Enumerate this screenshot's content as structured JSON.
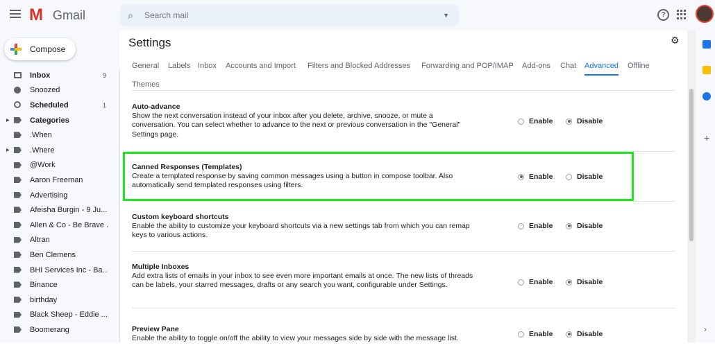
{
  "app": {
    "name": "Gmail"
  },
  "search": {
    "placeholder": "Search mail"
  },
  "sidebar": {
    "compose_label": "Compose",
    "items": [
      {
        "label": "Inbox",
        "count": "9",
        "bold": true,
        "icon": "inbox"
      },
      {
        "label": "Snoozed",
        "count": "",
        "bold": false,
        "icon": "clock"
      },
      {
        "label": "Scheduled",
        "count": "1",
        "bold": true,
        "icon": "sched"
      },
      {
        "label": "Categories",
        "count": "",
        "bold": true,
        "icon": "label",
        "arrow": true
      },
      {
        "label": ".When",
        "count": "",
        "bold": false,
        "icon": "label"
      },
      {
        "label": ".Where",
        "count": "",
        "bold": false,
        "icon": "label",
        "arrow": true
      },
      {
        "label": "@Work",
        "count": "",
        "bold": false,
        "icon": "label"
      },
      {
        "label": "Aaron Freeman",
        "count": "",
        "bold": false,
        "icon": "label"
      },
      {
        "label": "Advertising",
        "count": "",
        "bold": false,
        "icon": "label"
      },
      {
        "label": "Afeisha Burgin - 9 Ju...",
        "count": "",
        "bold": false,
        "icon": "label"
      },
      {
        "label": "Allen & Co - Be Brave ...",
        "count": "",
        "bold": false,
        "icon": "label"
      },
      {
        "label": "Altran",
        "count": "",
        "bold": false,
        "icon": "label"
      },
      {
        "label": "Ben Clemens",
        "count": "",
        "bold": false,
        "icon": "label"
      },
      {
        "label": "BHI Services Inc - Ba...",
        "count": "",
        "bold": false,
        "icon": "label"
      },
      {
        "label": "Binance",
        "count": "",
        "bold": false,
        "icon": "label"
      },
      {
        "label": "birthday",
        "count": "",
        "bold": false,
        "icon": "label"
      },
      {
        "label": "Black Sheep - Eddie ...",
        "count": "",
        "bold": false,
        "icon": "label"
      },
      {
        "label": "Boomerang",
        "count": "",
        "bold": false,
        "icon": "label"
      }
    ]
  },
  "settings": {
    "title": "Settings",
    "tabs": [
      "General",
      "Labels",
      "Inbox",
      "Accounts and Import",
      "Filters and Blocked Addresses",
      "Forwarding and POP/IMAP",
      "Add-ons",
      "Chat",
      "Advanced",
      "Offline",
      "Themes"
    ],
    "active_tab": "Advanced",
    "enable_label": "Enable",
    "disable_label": "Disable",
    "rows": [
      {
        "title": "Auto-advance",
        "desc": "Show the next conversation instead of your inbox after you delete, archive, snooze, or mute a conversation. You can select whether to advance to the next or previous conversation in the \"General\" Settings page.",
        "selected": "Disable"
      },
      {
        "title": "Canned Responses (Templates)",
        "desc": "Create a templated response by saving common messages using a button in compose toolbar. Also automatically send templated responses using filters.",
        "selected": "Enable"
      },
      {
        "title": "Custom keyboard shortcuts",
        "desc": "Enable the ability to customize your keyboard shortcuts via a new settings tab from which you can remap keys to various actions.",
        "selected": "Disable"
      },
      {
        "title": "Multiple Inboxes",
        "desc": "Add extra lists of emails in your inbox to see even more important emails at once. The new lists of threads can be labels, your starred messages, drafts or any search you want, configurable under Settings.",
        "selected": "Disable"
      },
      {
        "title": "Preview Pane",
        "desc": "Enable the ability to toggle on/off the ability to view your messages side by side with the message list.",
        "selected": "Disable"
      }
    ]
  },
  "colors": {
    "highlight": "#22e422",
    "accent": "#1a73e8",
    "brand_red": "#d93025"
  }
}
